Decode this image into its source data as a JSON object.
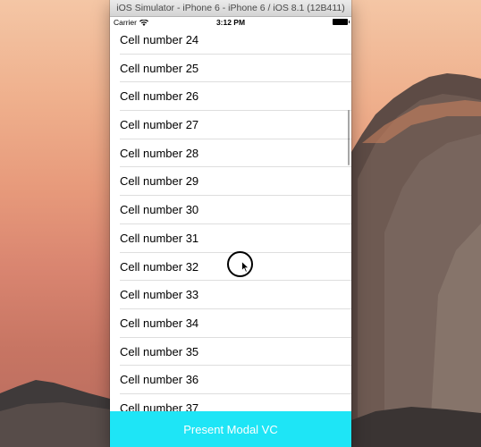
{
  "window": {
    "title": "iOS Simulator - iPhone 6 - iPhone 6 / iOS 8.1 (12B411)"
  },
  "status_bar": {
    "carrier": "Carrier",
    "time": "3:12 PM",
    "wifi_icon": "wifi-icon",
    "battery_icon": "battery-icon"
  },
  "table": {
    "cells": [
      {
        "label": "Cell number 24"
      },
      {
        "label": "Cell number 25"
      },
      {
        "label": "Cell number 26"
      },
      {
        "label": "Cell number 27"
      },
      {
        "label": "Cell number 28"
      },
      {
        "label": "Cell number 29"
      },
      {
        "label": "Cell number 30"
      },
      {
        "label": "Cell number 31"
      },
      {
        "label": "Cell number 32"
      },
      {
        "label": "Cell number 33"
      },
      {
        "label": "Cell number 34"
      },
      {
        "label": "Cell number 35"
      },
      {
        "label": "Cell number 36"
      },
      {
        "label": "Cell number 37"
      }
    ]
  },
  "button": {
    "label": "Present Modal VC",
    "color": "#1ee5f6"
  }
}
